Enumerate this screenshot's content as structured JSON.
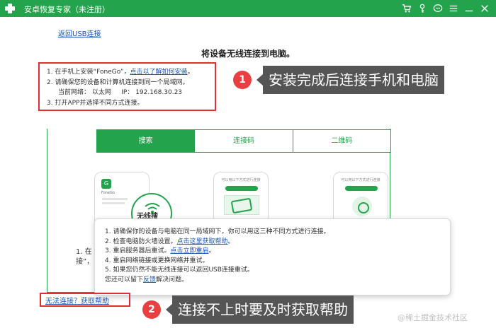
{
  "window": {
    "title": "安卓恢复专家（未注册）",
    "toolbar_icons": [
      "cart-icon",
      "key-icon",
      "chat-icon",
      "menu-icon",
      "minimize-icon",
      "close-icon"
    ]
  },
  "back_link": "返回USB连接",
  "main_title": "将设备无线连接到电脑。",
  "steps": {
    "s1_prefix": "1.  在手机上安装“FoneGo”，",
    "s1_link": "点击以了解如何安装",
    "s1_suffix": "。",
    "s2": "2.  请确保您的设备和计算机连接到同一个局域网。",
    "network_label": "当前网络：",
    "network_type": "以太网",
    "ip_label": "IP：",
    "ip_value": "192.168.30.23",
    "s3": "3.  打开APP并选择不同方式连接。"
  },
  "callout1": {
    "number": "1",
    "text": "安装完成后连接手机和电脑"
  },
  "callout2": {
    "number": "2",
    "text": "连接不上时要及时获取帮助"
  },
  "tabs": [
    {
      "label": "搜索",
      "active": true
    },
    {
      "label": "连接码",
      "active": false
    },
    {
      "label": "二维码",
      "active": false
    }
  ],
  "phone_cards": {
    "app_name": "FoneGo",
    "caption": "可以用以下方式进行连接"
  },
  "wifi_label": "无线搜",
  "hidden_text": {
    "line1": "1. 在",
    "line2": "接”，"
  },
  "tips": {
    "t1": "1.  请确保你的设备与电脑在同一局域网下，你可以用这三种不同方式进行连接。",
    "t2_prefix": "2.  检查电脑防火墙设置。",
    "t2_link": "点击这里获取帮助",
    "t2_suffix": "。",
    "t3_prefix": "3.  重启服务器后重试。",
    "t3_link": "点击立即重启",
    "t3_suffix": "。",
    "t4": "4.  重启网络链接或更换网络并重试。",
    "t5": "5.  如果您仍然不能无线连接可以返回USB连接重试。",
    "t6_prefix": "您还可以留下",
    "t6_link": "反馈",
    "t6_suffix": "解决问题。"
  },
  "help_link": "无法连接？获取帮助",
  "watermark": "@稀土掘金技术社区",
  "colors": {
    "brand_green": "#23a44c",
    "highlight_red": "#e0312f",
    "callout_gray": "#555555",
    "link_blue": "#1a53b8"
  }
}
